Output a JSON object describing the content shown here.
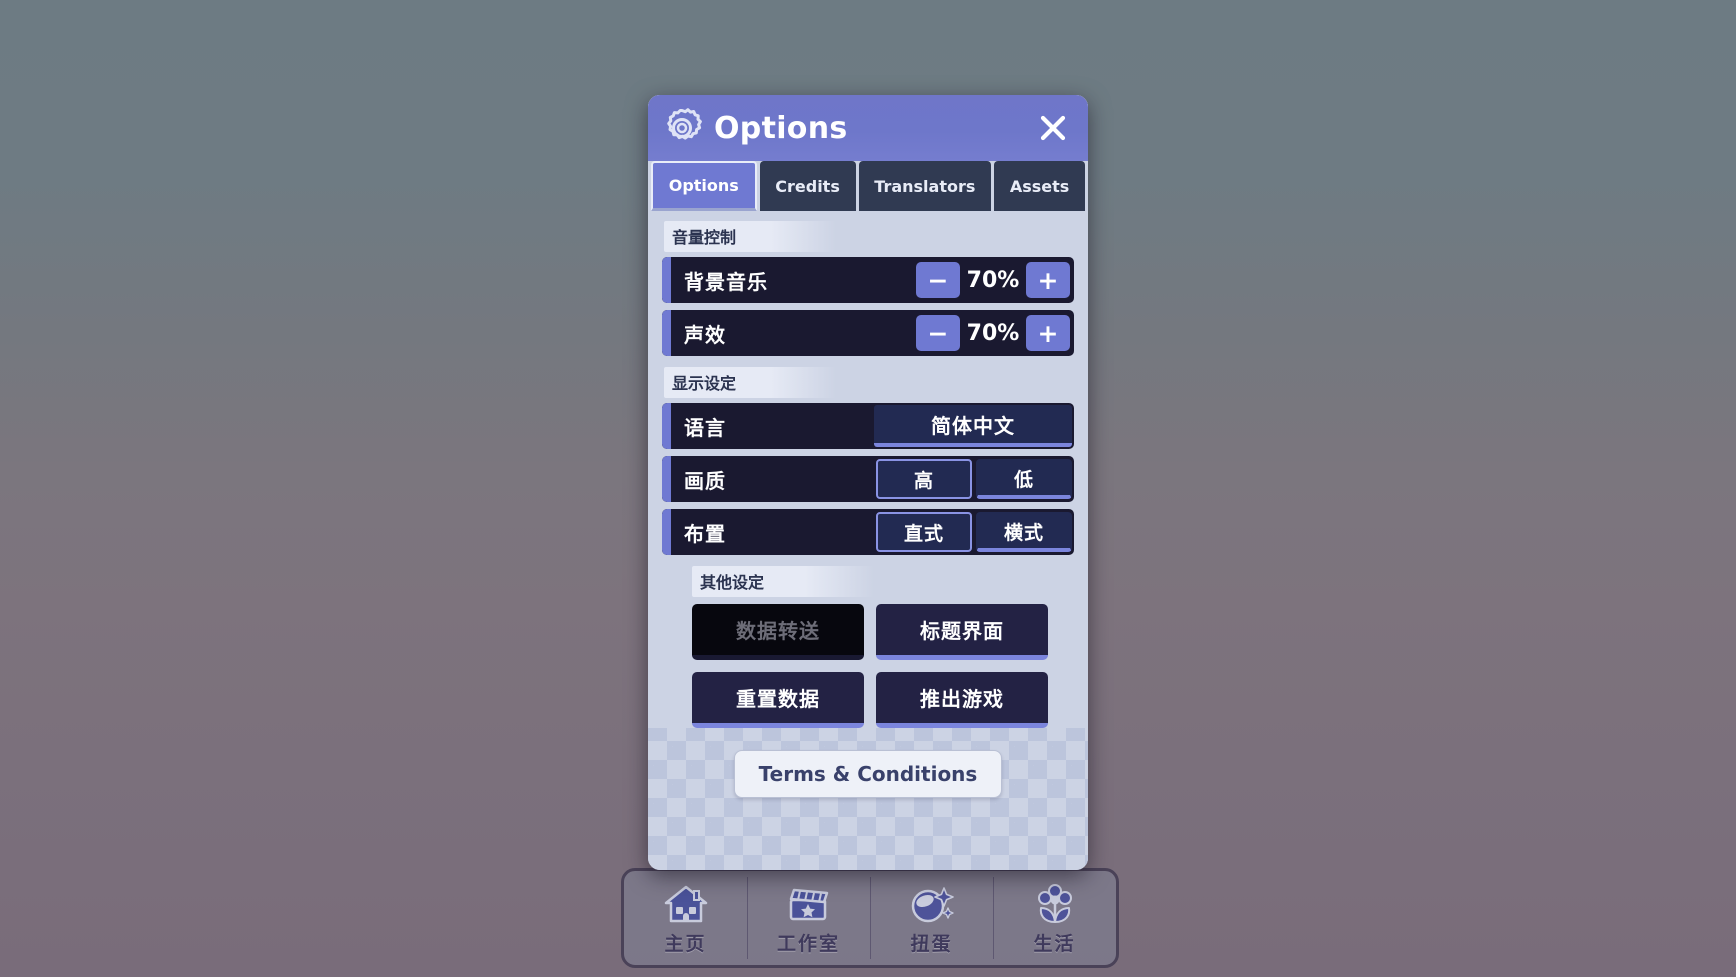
{
  "modal": {
    "title": "Options",
    "gear_icon": "gear-icon",
    "close_icon": "close-icon",
    "accent_color": "#6f79d2",
    "panel_bg": "#ccd3e4",
    "row_bg": "#1a1930"
  },
  "tabs": [
    {
      "label": "Options",
      "active": true
    },
    {
      "label": "Credits",
      "active": false
    },
    {
      "label": "Translators",
      "active": false
    },
    {
      "label": "Assets",
      "active": false
    }
  ],
  "sections": {
    "volume": {
      "header": "音量控制",
      "rows": [
        {
          "label": "背景音乐",
          "value": "70%",
          "minus": "−",
          "plus": "+"
        },
        {
          "label": "声效",
          "value": "70%",
          "minus": "−",
          "plus": "+"
        }
      ]
    },
    "display": {
      "header": "显示设定",
      "language": {
        "label": "语言",
        "value": "简体中文"
      },
      "quality": {
        "label": "画质",
        "options": [
          "高",
          "低"
        ],
        "selected": "高"
      },
      "layout": {
        "label": "布置",
        "options": [
          "直式",
          "横式"
        ],
        "selected": "直式"
      }
    },
    "other": {
      "header": "其他设定",
      "buttons": [
        {
          "label": "数据转送",
          "disabled": true
        },
        {
          "label": "标题界面",
          "disabled": false
        },
        {
          "label": "重置数据",
          "disabled": false
        },
        {
          "label": "推出游戏",
          "disabled": false
        }
      ]
    }
  },
  "terms": {
    "label": "Terms & Conditions"
  },
  "bottom_nav": [
    {
      "label": "主页",
      "icon": "house-icon"
    },
    {
      "label": "工作室",
      "icon": "clapperboard-icon"
    },
    {
      "label": "扭蛋",
      "icon": "gacha-ball-icon"
    },
    {
      "label": "生活",
      "icon": "flower-icon"
    }
  ]
}
